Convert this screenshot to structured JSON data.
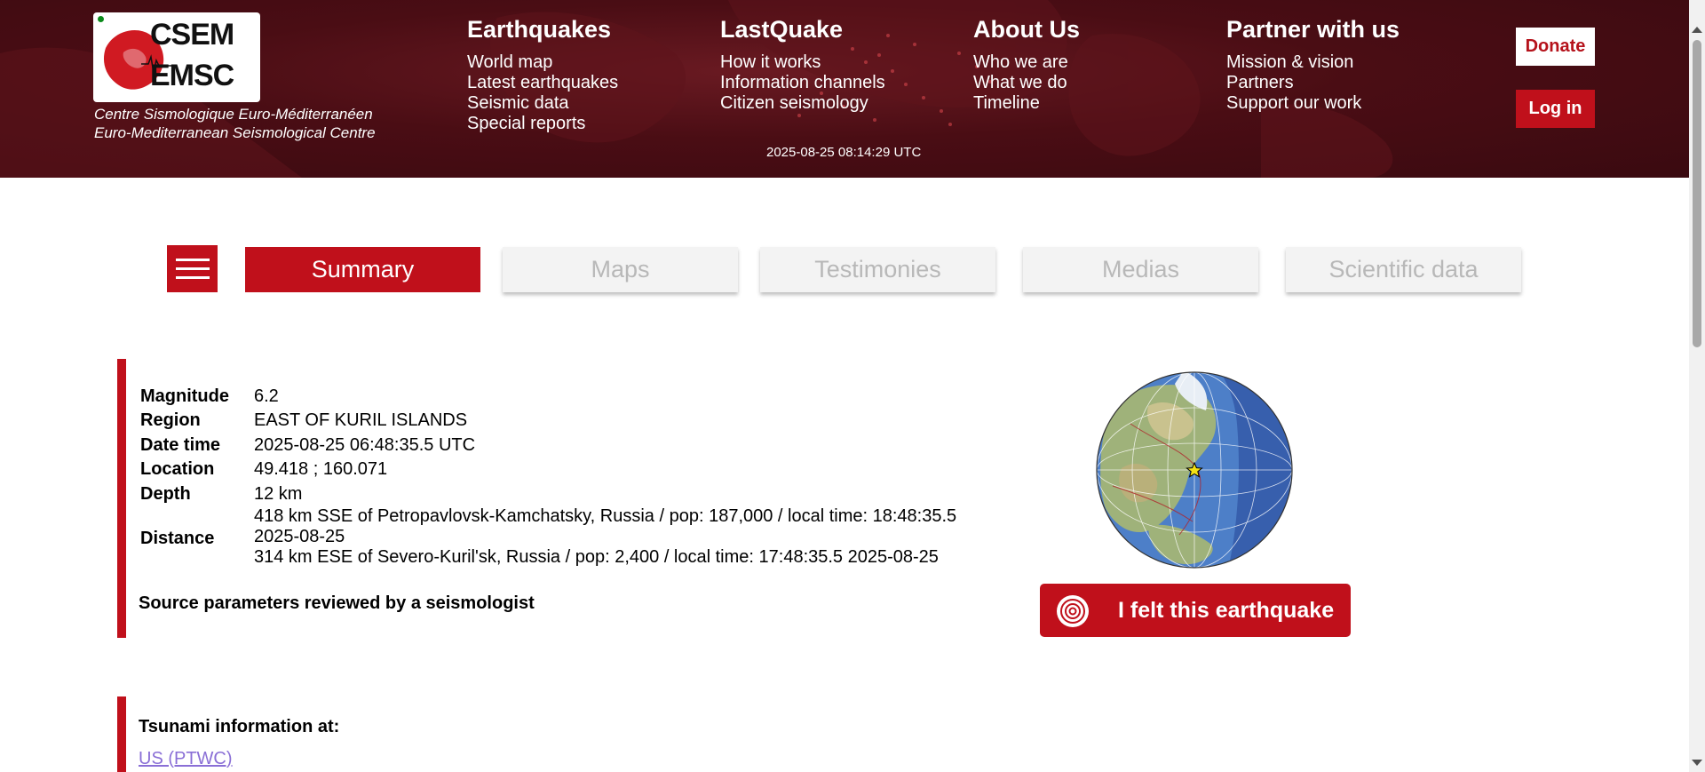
{
  "header": {
    "logo": {
      "line1": "CSEM",
      "line2": "EMSC",
      "subtitle_fr": "Centre Sismologique Euro-Méditerranéen",
      "subtitle_en": "Euro-Mediterranean Seismological Centre"
    },
    "nav": [
      {
        "title": "Earthquakes",
        "items": [
          "World map",
          "Latest earthquakes",
          "Seismic data",
          "Special reports"
        ]
      },
      {
        "title": "LastQuake",
        "items": [
          "How it works",
          "Information channels",
          "Citizen seismology"
        ]
      },
      {
        "title": "About Us",
        "items": [
          "Who we are",
          "What we do",
          "Timeline"
        ]
      },
      {
        "title": "Partner with us",
        "items": [
          "Mission & vision",
          "Partners",
          "Support our work"
        ]
      }
    ],
    "clock": "2025-08-25 08:14:29 UTC",
    "donate_label": "Donate",
    "login_label": "Log in"
  },
  "tabs": [
    "Summary",
    "Maps",
    "Testimonies",
    "Medias",
    "Scientific data"
  ],
  "event": {
    "magnitude_label": "Magnitude",
    "magnitude": "6.2",
    "region_label": "Region",
    "region": "EAST OF KURIL ISLANDS",
    "datetime_label": "Date time",
    "datetime": "2025-08-25 06:48:35.5 UTC",
    "location_label": "Location",
    "location": "49.418 ; 160.071",
    "depth_label": "Depth",
    "depth": "12 km",
    "distance_label": "Distance",
    "distance_lines": [
      "418 km SSE of Petropavlovsk-Kamchatsky, Russia / pop: 187,000 / local time: 18:48:35.5",
      "2025-08-25",
      "314 km ESE of Severo-Kuril'sk, Russia / pop: 2,400 / local time: 17:48:35.5 2025-08-25"
    ],
    "reviewed": "Source parameters reviewed by a seismologist"
  },
  "felt_button": "I felt this earthquake",
  "tsunami": {
    "title": "Tsunami information at:",
    "link": "US (PTWC)"
  },
  "colors": {
    "brand_red": "#c0101b",
    "header_dark": "#4a0d14",
    "tab_inactive_bg": "#f3f3f3",
    "tab_inactive_text": "#b8b8b8",
    "link": "#8a6fd6"
  }
}
